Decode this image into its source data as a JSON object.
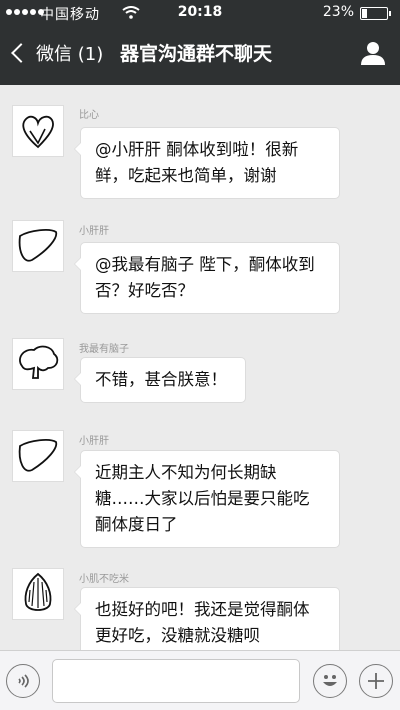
{
  "status_bar": {
    "carrier": "中国移动",
    "time": "20:18",
    "battery_percent": "23%",
    "battery_level": 0.23
  },
  "nav": {
    "back_label": "微信 (1)",
    "title": "器官沟通群不聊天",
    "profile_icon": "person-icon"
  },
  "messages": [
    {
      "sender": "比心",
      "avatar": "heart-doodle",
      "text_lines": [
        "@小肝肝 酮体收到啦！很新",
        "鲜，吃起来也简单，谢谢"
      ]
    },
    {
      "sender": "小肝肝",
      "avatar": "liver-doodle",
      "text_lines": [
        "@我最有脑子 陛下，酮体收到",
        "否？好吃否？"
      ]
    },
    {
      "sender": "我最有脑子",
      "avatar": "brain-doodle",
      "text_lines": [
        "不错，甚合朕意！"
      ]
    },
    {
      "sender": "小肝肝",
      "avatar": "liver-doodle",
      "text_lines": [
        "近期主人不知为何长期缺",
        "糖……大家以后怕是要只能吃",
        "酮体度日了"
      ]
    },
    {
      "sender": "小肌不吃米",
      "avatar": "muscle-doodle",
      "text_lines": [
        "也挺好的吧！我还是觉得酮体",
        "更好吃，没糖就没糖呗"
      ]
    }
  ],
  "input_bar": {
    "voice_icon": "voice-icon",
    "emoji_icon": "emoji-icon",
    "plus_icon": "plus-icon"
  },
  "colors": {
    "header_bg": "#2e3132",
    "chat_bg": "#ebebeb",
    "bubble_bg": "#ffffff"
  }
}
